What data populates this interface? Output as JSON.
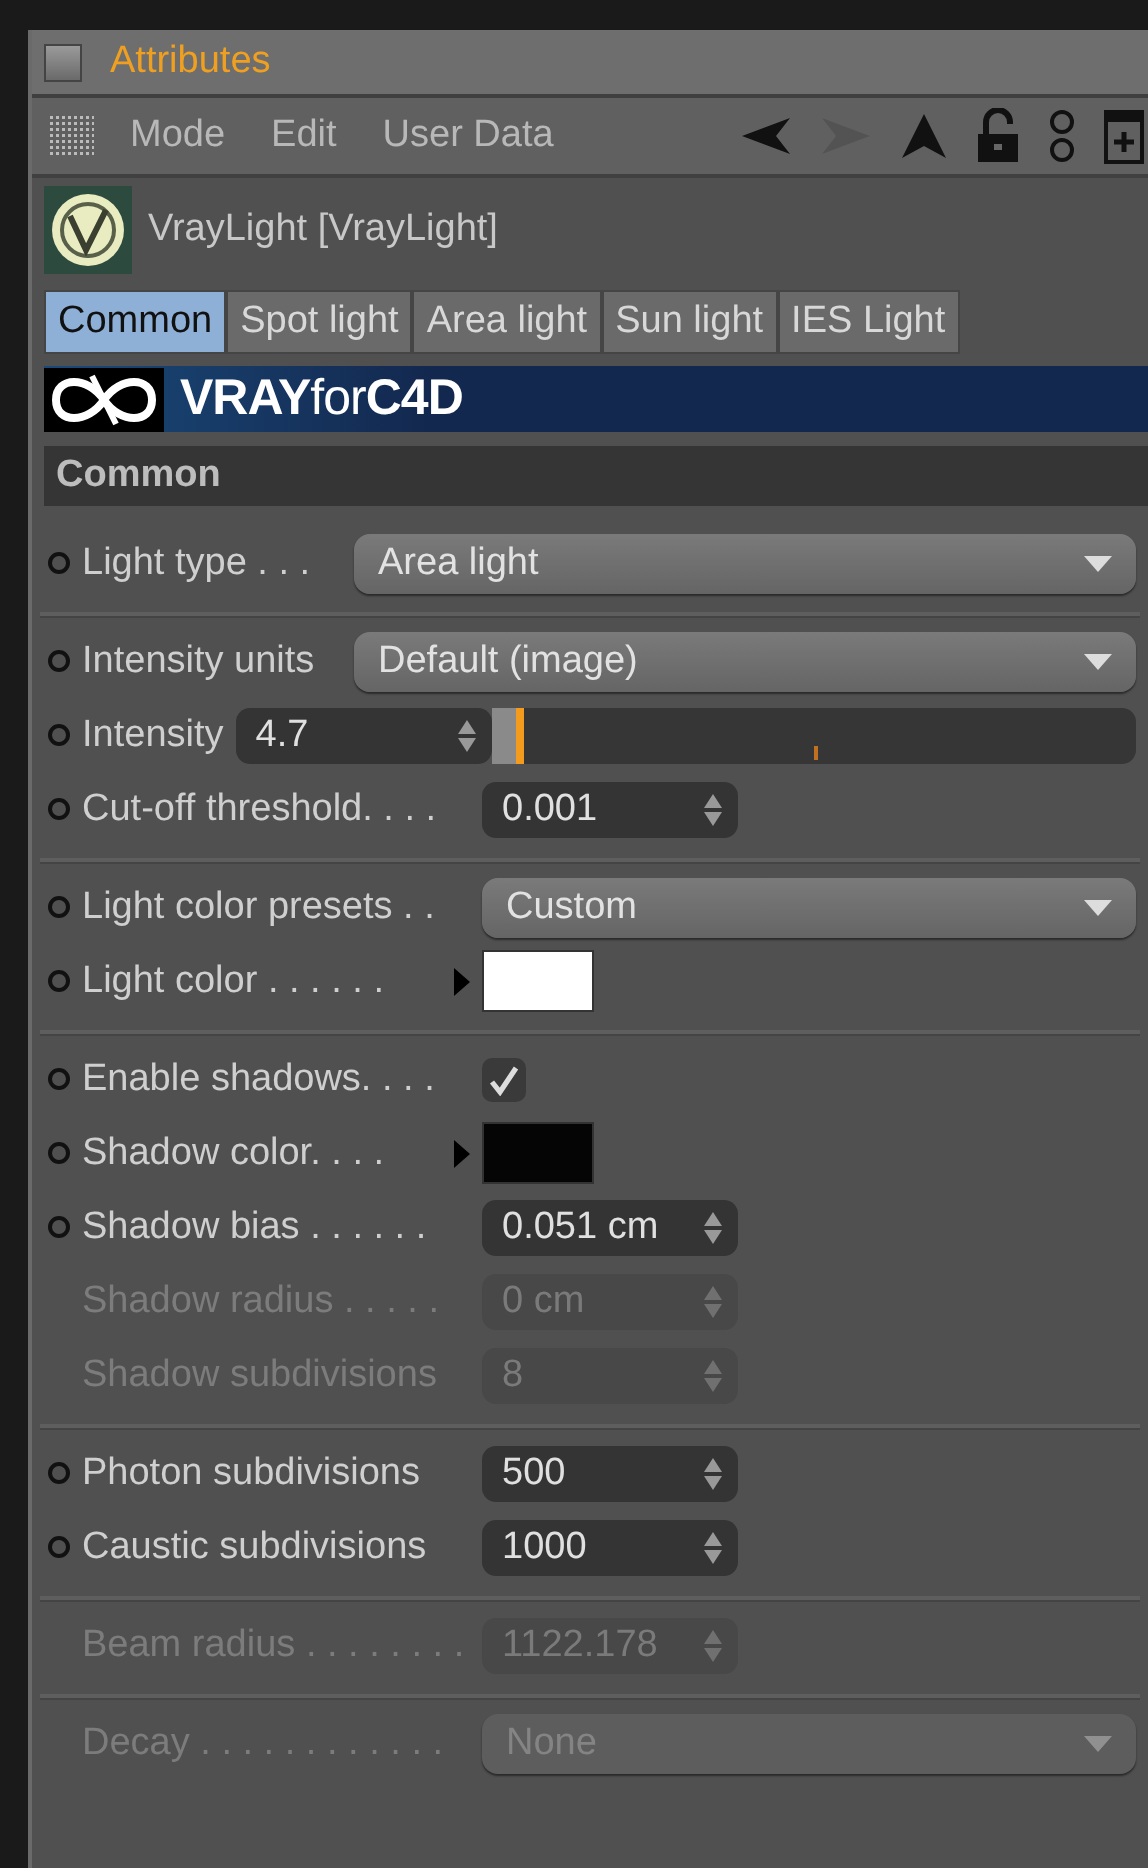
{
  "window": {
    "title": "Attributes"
  },
  "menu": [
    {
      "label": "Mode"
    },
    {
      "label": "Edit"
    },
    {
      "label": "User Data"
    }
  ],
  "toolbar": [
    {
      "kind": "back",
      "disabled": false
    },
    {
      "kind": "forward",
      "disabled": true
    },
    {
      "kind": "up",
      "disabled": false
    },
    {
      "kind": "lock",
      "disabled": false
    },
    {
      "kind": "link",
      "disabled": false
    },
    {
      "kind": "new",
      "disabled": false
    }
  ],
  "object": {
    "name": "VrayLight [VrayLight]"
  },
  "tabs": [
    {
      "label": "Common",
      "selected": true
    },
    {
      "label": "Spot light",
      "selected": false
    },
    {
      "label": "Area light",
      "selected": false
    },
    {
      "label": "Sun light",
      "selected": false
    },
    {
      "label": "IES Light",
      "selected": false
    }
  ],
  "banner": {
    "text": "**VRAY**for**C4D**"
  },
  "section": {
    "title": "Common"
  },
  "groups": [
    {
      "rows": [
        {
          "kind": "dropdown",
          "label": "Light type . . .",
          "value": "Area light",
          "disabled": false
        }
      ]
    },
    {
      "rows": [
        {
          "kind": "dropdown",
          "label": "Intensity units",
          "value": "Default (image)",
          "disabled": false
        },
        {
          "kind": "slider",
          "label": "Intensity",
          "value": "4.7",
          "level": 0.05,
          "disabled": false
        },
        {
          "kind": "number",
          "label": "Cut-off threshold. . . .",
          "value": "0.001",
          "disabled": false
        }
      ]
    },
    {
      "rows": [
        {
          "kind": "dropdown",
          "label": "Light color presets . .",
          "value": "Custom",
          "disabled": false
        },
        {
          "kind": "color",
          "label": "Light color . . . . . .",
          "color": "#ffffff",
          "disabled": false
        }
      ]
    },
    {
      "rows": [
        {
          "kind": "checkbox",
          "label": "Enable shadows. . . .",
          "checked": true,
          "disabled": false
        },
        {
          "kind": "color",
          "label": "Shadow color. . . .",
          "color": "#050505",
          "disabled": false
        },
        {
          "kind": "number",
          "label": "Shadow bias . . . . . .",
          "value": "0.051 cm",
          "disabled": false
        },
        {
          "kind": "number",
          "label": "Shadow radius . . . . .",
          "value": "0 cm",
          "disabled": true
        },
        {
          "kind": "number",
          "label": "Shadow subdivisions",
          "value": "8",
          "disabled": true
        }
      ]
    },
    {
      "rows": [
        {
          "kind": "number",
          "label": "Photon subdivisions",
          "value": "500",
          "disabled": false
        },
        {
          "kind": "number",
          "label": "Caustic subdivisions",
          "value": "1000",
          "disabled": false
        }
      ]
    },
    {
      "rows": [
        {
          "kind": "number",
          "label": "Beam radius . . . . . . . .",
          "value": "1122.178",
          "disabled": true
        }
      ]
    },
    {
      "rows": [
        {
          "kind": "dropdown",
          "label": "Decay . . . . . . . . . . . .",
          "value": "None",
          "disabled": true
        }
      ]
    }
  ]
}
